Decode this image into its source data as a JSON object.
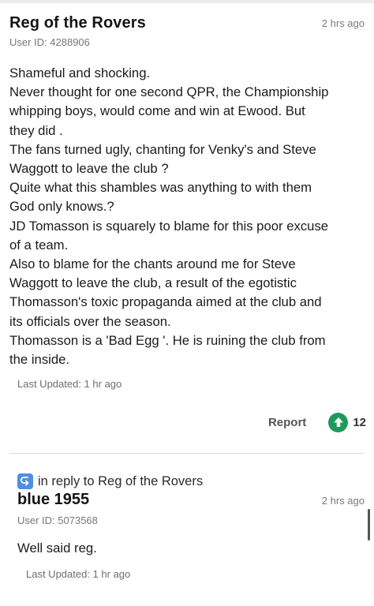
{
  "comment": {
    "username": "Reg of the Rovers",
    "timestamp": "2 hrs ago",
    "user_id": "User ID: 4288906",
    "body_lines": [
      "Shameful and shocking.",
      "Never thought for one second QPR, the Championship",
      "whipping boys, would come and win at Ewood. But",
      "they did .",
      "The fans turned ugly, chanting for Venky's and Steve",
      "Waggott to leave the club ?",
      "Quite what this shambles was anything to with them",
      "God only knows.?",
      "JD Tomasson is squarely to blame for this poor excuse",
      "of a team.",
      "Also to blame for the chants around me for Steve",
      "Waggott to leave the club, a result of the egotistic",
      "Thomasson's toxic propaganda aimed at the club and",
      "its officials over the season.",
      "Thomasson is a 'Bad Egg '. He is ruining the club from",
      "the inside."
    ],
    "last_updated": "Last Updated: 1 hr ago",
    "report_label": "Report",
    "upvote_icon": "arrow-up-icon",
    "upvote_count": "12",
    "colors": {
      "upvote": "#1f9a5a"
    }
  },
  "reply": {
    "context_icon": "reply-arrow-icon",
    "context_text": "in reply to Reg of the Rovers",
    "username": "blue 1955",
    "timestamp": "2 hrs ago",
    "user_id": "User ID: 5073568",
    "body": "Well said reg.",
    "last_updated": "Last Updated: 1 hr ago",
    "colors": {
      "reply_icon": "#4f8fe0"
    }
  }
}
